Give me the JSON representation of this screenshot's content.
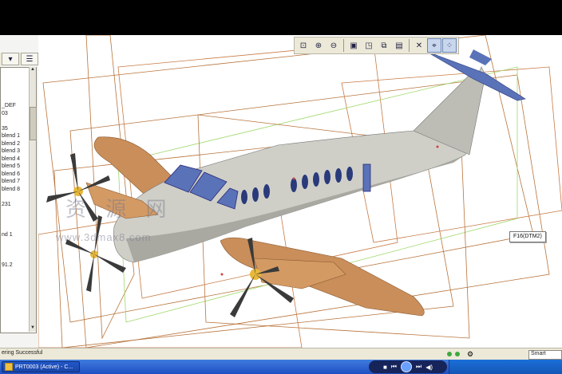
{
  "toolbar": {
    "buttons": [
      {
        "name": "zoom-fit-icon",
        "glyph": "⊡"
      },
      {
        "name": "zoom-in-icon",
        "glyph": "⊕"
      },
      {
        "name": "zoom-out-icon",
        "glyph": "⊖"
      },
      {
        "name": "repaint-icon",
        "glyph": "▣"
      },
      {
        "name": "orient-icon",
        "glyph": "◳"
      },
      {
        "name": "saved-views-icon",
        "glyph": "⧉"
      },
      {
        "name": "layers-icon",
        "glyph": "▤"
      },
      {
        "name": "datum-planes-icon",
        "glyph": "✕"
      },
      {
        "name": "datum-axes-icon",
        "glyph": "⌖"
      },
      {
        "name": "datum-points-icon",
        "glyph": "⁘"
      }
    ]
  },
  "tree": {
    "items": [
      "_DEF",
      "03",
      "",
      "35",
      "blend 1",
      "blend 2",
      "blend 3",
      "blend 4",
      "blend 5",
      "blend 6",
      "blend 7",
      "blend 8",
      "",
      "231",
      "",
      "",
      "",
      "nd 1",
      "",
      "",
      "",
      "91.2"
    ]
  },
  "tooltip": {
    "label": "F16(DTM2)"
  },
  "watermark": {
    "text": "资 源 网",
    "sub": "www.3dmax8.com"
  },
  "status": {
    "message": "ering Successful",
    "filter": "Smart"
  },
  "taskbar": {
    "task_label": "PRT0003 (Active) - C..."
  },
  "colors": {
    "fuselage": "#c9c9c2",
    "wing": "#c98e5a",
    "accent_plane": "#b8733a",
    "green_plane": "#9fd86a",
    "taskbar": "#245edb"
  }
}
